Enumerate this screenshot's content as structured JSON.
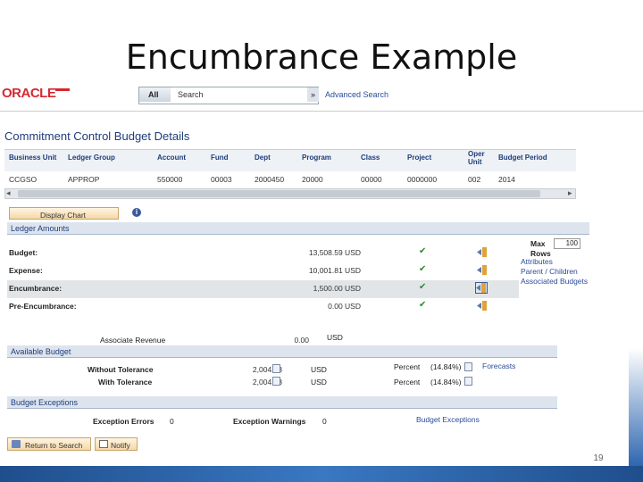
{
  "slide": {
    "title": "Encumbrance Example",
    "page_number": "19"
  },
  "topbar": {
    "logo": "ORACLE",
    "search_scope": "All",
    "search_placeholder": "Search",
    "search_go": "»",
    "advanced_search": "Advanced Search"
  },
  "page": {
    "heading": "Commitment Control Budget Details"
  },
  "grid": {
    "headers": [
      "Business Unit",
      "Ledger Group",
      "Account",
      "Fund",
      "Dept",
      "Program",
      "Class",
      "Project",
      "Oper Unit",
      "Budget Period"
    ],
    "row": [
      "CCGSO",
      "APPROP",
      "550000",
      "00003",
      "2000450",
      "20000",
      "00000",
      "0000000",
      "002",
      "2014"
    ],
    "scroll_left": "◂",
    "scroll_right": "▸"
  },
  "buttons": {
    "display_chart": "Display Chart",
    "info": "i"
  },
  "ledger_amounts": {
    "title": "Ledger Amounts",
    "rows": [
      {
        "label": "Budget:",
        "value": "13,508.59 USD"
      },
      {
        "label": "Expense:",
        "value": "10,001.81 USD"
      },
      {
        "label": "Encumbrance:",
        "value": "1,500.00 USD"
      },
      {
        "label": "Pre-Encumbrance:",
        "value": "0.00 USD"
      }
    ],
    "max_rows_label": "Max Rows",
    "max_rows_value": "100",
    "links": [
      "Attributes",
      "Parent / Children",
      "Associated Budgets"
    ],
    "associate_revenue_label": "Associate Revenue",
    "associate_revenue_value": "0.00",
    "associate_revenue_currency": "USD"
  },
  "available_budget": {
    "title": "Available Budget",
    "without_label": "Without Tolerance",
    "without_value": "2,004.78",
    "with_label": "With Tolerance",
    "with_value": "2,004.78",
    "currency": "USD",
    "percent_label": "Percent",
    "percent_value": "(14.84%)",
    "forecasts": "Forecasts"
  },
  "budget_exceptions": {
    "title": "Budget Exceptions",
    "errors_label": "Exception Errors",
    "errors_value": "0",
    "warnings_label": "Exception Warnings",
    "warnings_value": "0",
    "link": "Budget Exceptions"
  },
  "footer_buttons": {
    "return": "Return to Search",
    "notify": "Notify"
  }
}
